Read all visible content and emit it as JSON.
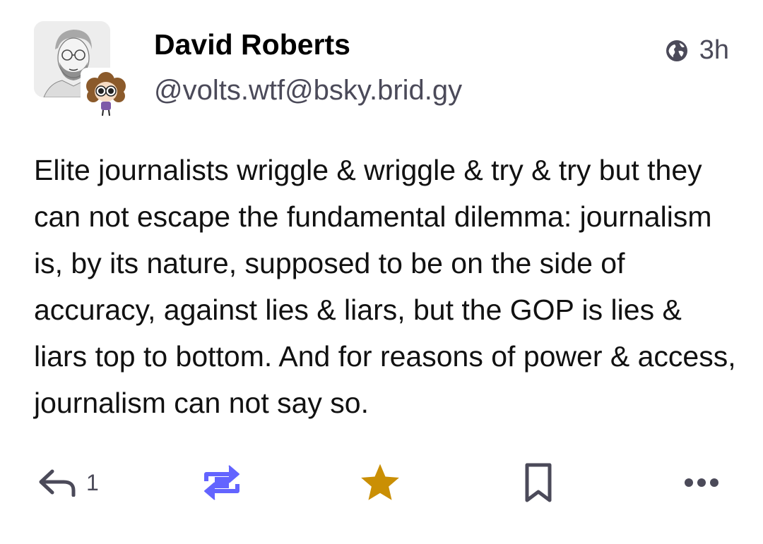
{
  "status": {
    "author": {
      "display_name": "David Roberts",
      "handle": "@volts.wtf@bsky.brid.gy"
    },
    "visibility_icon": "globe-icon",
    "relative_time": "3h",
    "content": "Elite journalists wriggle & wriggle & try & try but they can not escape the fundamental dilemma: journalism is, by its nature, supposed to be on the side of accuracy, against lies & liars, but the GOP is lies & liars top to bottom. And for reasons of power & access, journalism can not say so.",
    "actions": {
      "reply_count": "1",
      "reply_icon": "reply-icon",
      "boost_icon": "boost-icon",
      "favourite_icon": "star-icon",
      "bookmark_icon": "bookmark-icon",
      "more_icon": "more-icon"
    }
  },
  "colors": {
    "muted_text": "#4b4a59",
    "boost_active": "#6364ff",
    "favourite_active": "#ca8f04"
  }
}
